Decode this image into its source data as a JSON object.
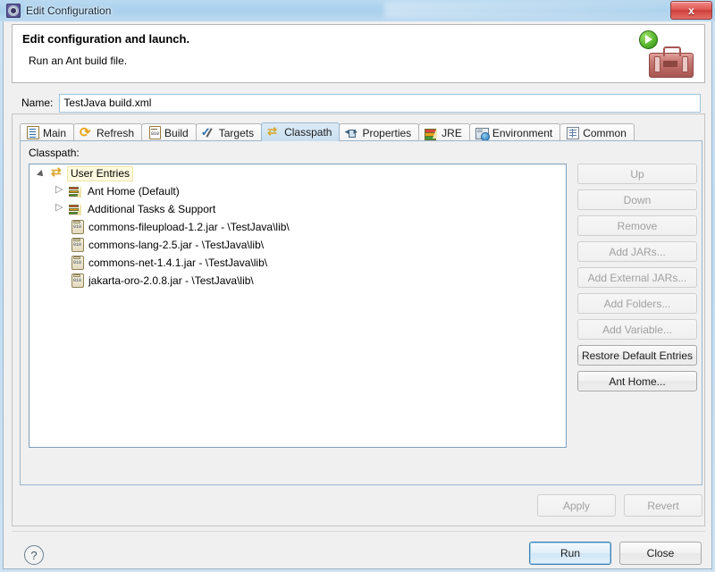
{
  "window": {
    "title": "Edit Configuration",
    "title_icon": "gear-icon",
    "close_label": "x"
  },
  "header": {
    "title": "Edit configuration and launch.",
    "subtitle": "Run an Ant build file.",
    "image_icon": "ant-run-toolbox-icon"
  },
  "name_field": {
    "label": "Name:",
    "value": "TestJava build.xml",
    "placeholder": ""
  },
  "tabs": [
    {
      "label": "Main",
      "icon": "main-document-icon",
      "selected": false
    },
    {
      "label": "Refresh",
      "icon": "refresh-arrows-icon",
      "selected": false
    },
    {
      "label": "Build",
      "icon": "build-binary-icon",
      "selected": false
    },
    {
      "label": "Targets",
      "icon": "targets-check-icon",
      "selected": false
    },
    {
      "label": "Classpath",
      "icon": "classpath-arrows-icon",
      "selected": true
    },
    {
      "label": "Properties",
      "icon": "properties-icon",
      "selected": false
    },
    {
      "label": "JRE",
      "icon": "jre-books-icon",
      "selected": false
    },
    {
      "label": "Environment",
      "icon": "environment-icon",
      "selected": false
    },
    {
      "label": "Common",
      "icon": "common-grid-icon",
      "selected": false
    }
  ],
  "classpath": {
    "label": "Classpath:",
    "tree": [
      {
        "label": "User Entries",
        "icon": "classpath-arrows-icon",
        "level": 0,
        "twisty": "open",
        "selected": true
      },
      {
        "label": "Ant Home (Default)",
        "icon": "books-icon",
        "level": 1,
        "twisty": "closed",
        "selected": false
      },
      {
        "label": "Additional Tasks & Support",
        "icon": "books-icon",
        "level": 1,
        "twisty": "closed",
        "selected": false
      },
      {
        "label": "commons-fileupload-1.2.jar - \\TestJava\\lib\\",
        "icon": "jar-icon",
        "level": 1,
        "twisty": "none",
        "selected": false
      },
      {
        "label": "commons-lang-2.5.jar - \\TestJava\\lib\\",
        "icon": "jar-icon",
        "level": 1,
        "twisty": "none",
        "selected": false
      },
      {
        "label": "commons-net-1.4.1.jar - \\TestJava\\lib\\",
        "icon": "jar-icon",
        "level": 1,
        "twisty": "none",
        "selected": false
      },
      {
        "label": "jakarta-oro-2.0.8.jar - \\TestJava\\lib\\",
        "icon": "jar-icon",
        "level": 1,
        "twisty": "none",
        "selected": false
      }
    ],
    "buttons": [
      {
        "label": "Up",
        "enabled": false
      },
      {
        "label": "Down",
        "enabled": false
      },
      {
        "label": "Remove",
        "enabled": false
      },
      {
        "label": "Add JARs...",
        "enabled": false
      },
      {
        "label": "Add External JARs...",
        "enabled": false
      },
      {
        "label": "Add Folders...",
        "enabled": false
      },
      {
        "label": "Add Variable...",
        "enabled": false
      },
      {
        "label": "Restore Default Entries",
        "enabled": true
      },
      {
        "label": "Ant Home...",
        "enabled": true
      }
    ]
  },
  "footer": {
    "apply_label": "Apply",
    "apply_enabled": false,
    "revert_label": "Revert",
    "revert_enabled": false,
    "help_icon": "question-mark-icon",
    "help_label": "?",
    "run_label": "Run",
    "close_label": "Close"
  },
  "colors": {
    "titlebar": "#b9d9f0",
    "dialog_bg": "#f0f0f0",
    "selected_tab": "#c9dff1",
    "selection_highlight": "#fffbe0",
    "close_button": "#cf3f3a",
    "default_button_border": "#3c7fb1"
  }
}
